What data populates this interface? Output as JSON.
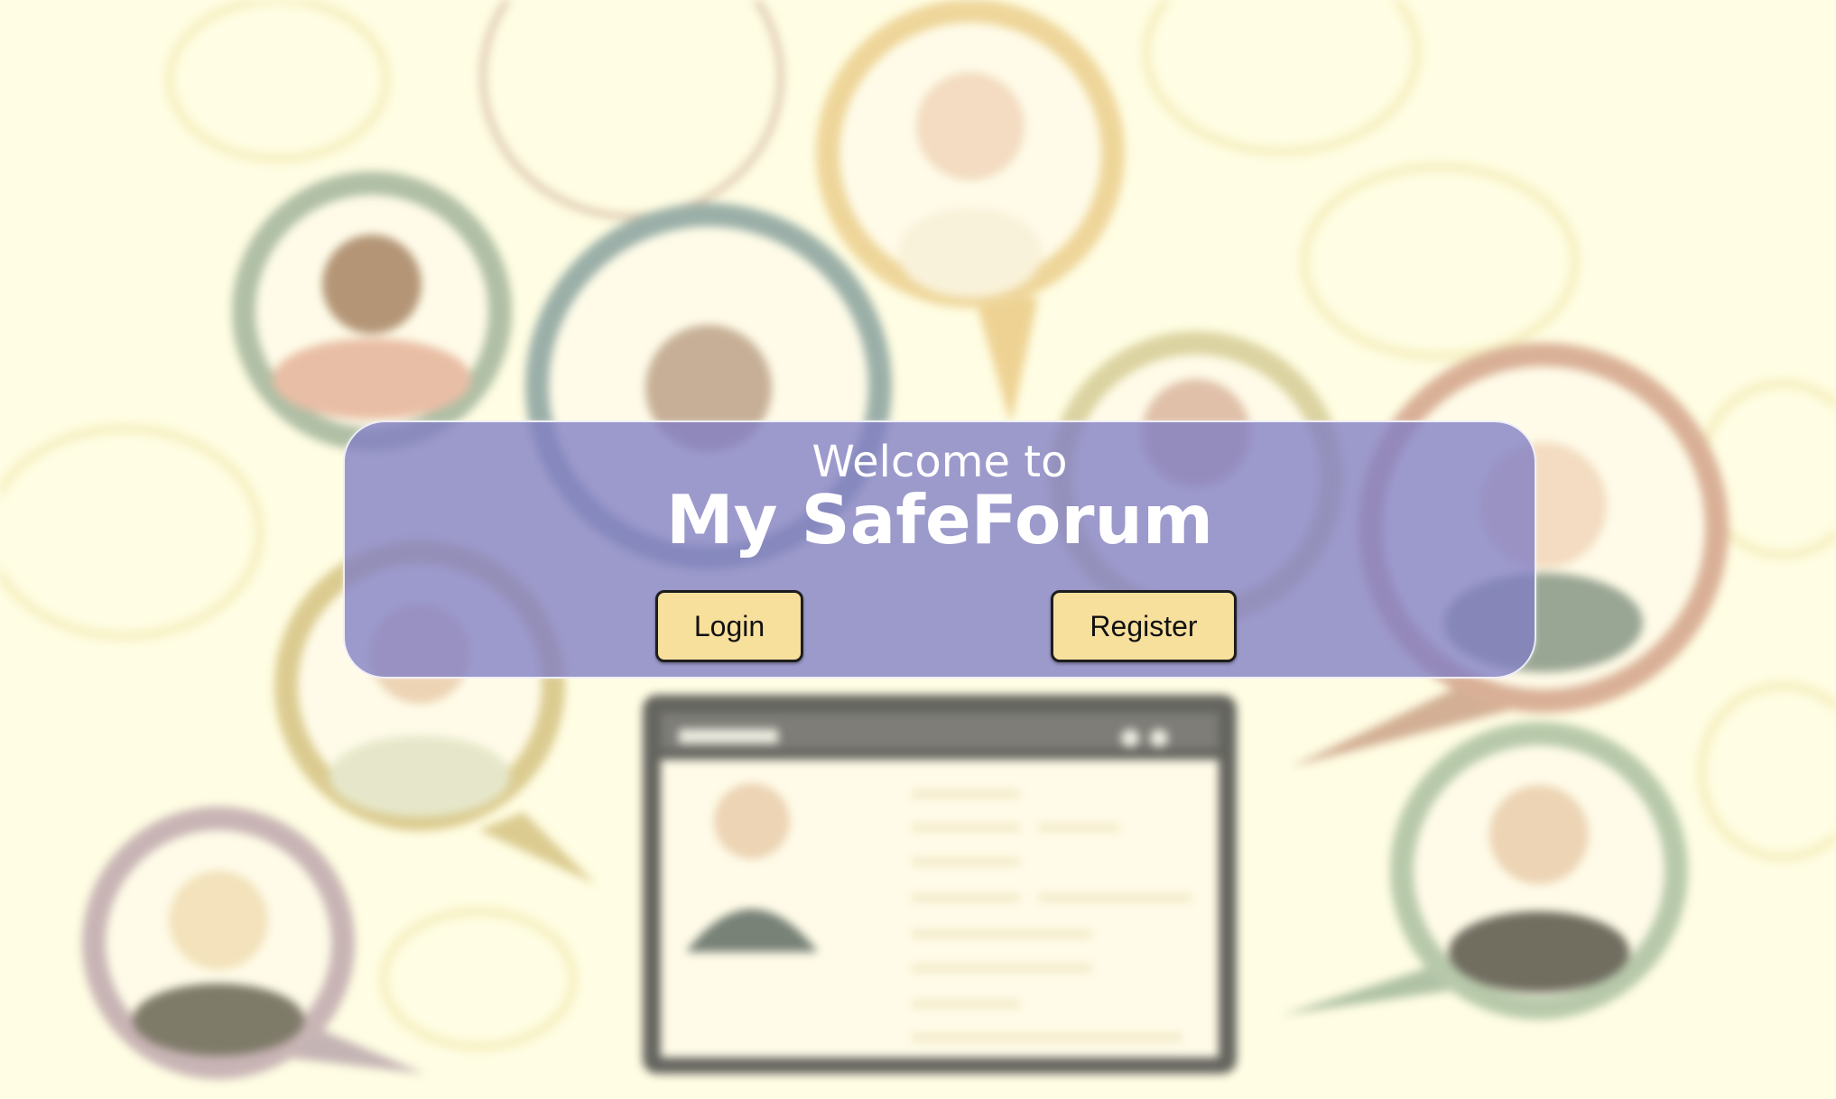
{
  "welcome": {
    "subtitle": "Welcome to",
    "title": "My SafeForum"
  },
  "actions": {
    "login_label": "Login",
    "register_label": "Register"
  },
  "colors": {
    "page_background": "#fffde3",
    "panel_background": "#807ec4",
    "button_background": "#f7df9c",
    "text_on_panel": "#ffffff"
  },
  "background_image": {
    "description_icon": "community-people-illustration"
  }
}
